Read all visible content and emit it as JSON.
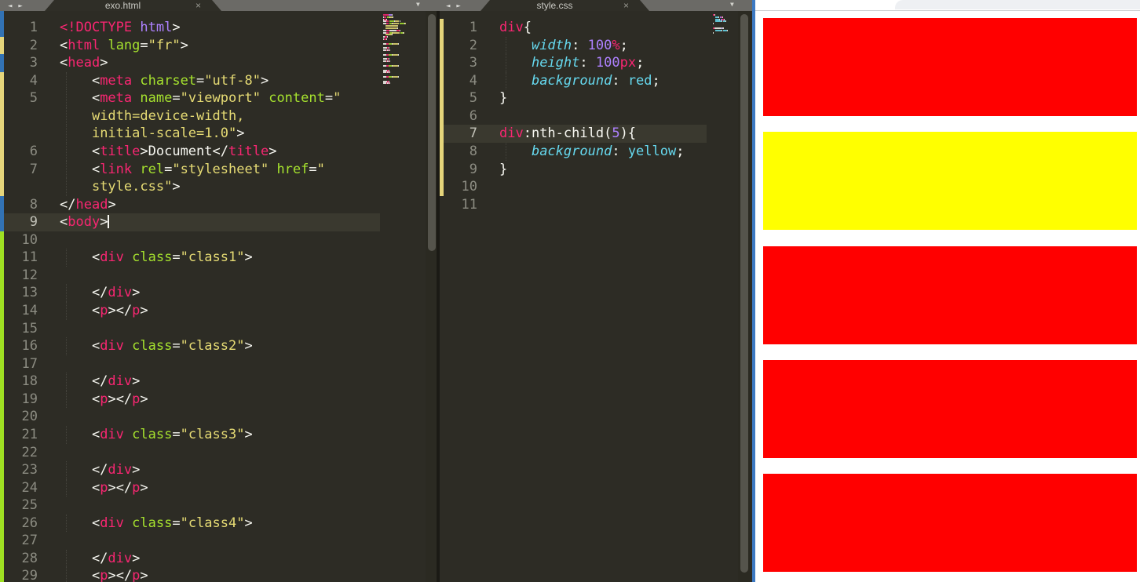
{
  "palette": {
    "w": "#f8f8f2",
    "p": "#f92672",
    "g": "#a6e22e",
    "y": "#e6db74",
    "u": "#ae81ff",
    "c": "#66d9ef",
    "cn": "#66d9ef",
    "marker_blue": "#3272b4",
    "marker_yellow": "#e5d57b",
    "marker_green": "#9ee022",
    "editor_bg": "#2d2c25",
    "tabbar_bg": "#6b6a66",
    "browser_accent": "#3c79c2",
    "red_block": "#ff0000",
    "yellow_block": "#ffff00"
  },
  "tabbar": {
    "back_arrow": "◄",
    "forward_arrow": "►",
    "overflow_arrow": "▼",
    "close_glyph": "×"
  },
  "left_pane": {
    "tab_title": "exo.html",
    "marker_column_bg": "blue",
    "rows": [
      {
        "n": "1",
        "m": "b",
        "seg": [
          [
            "<!DOCTYPE",
            "p"
          ],
          [
            " html",
            "u"
          ],
          [
            ">",
            "w"
          ]
        ]
      },
      {
        "n": "2",
        "m": "y",
        "seg": [
          [
            "<",
            "w"
          ],
          [
            "html",
            "p"
          ],
          [
            " ",
            "w"
          ],
          [
            "lang",
            "g"
          ],
          [
            "=",
            "w"
          ],
          [
            "\"fr\"",
            "y"
          ],
          [
            ">",
            "w"
          ]
        ]
      },
      {
        "n": "3",
        "m": "b",
        "seg": [
          [
            "<",
            "w"
          ],
          [
            "head",
            "p"
          ],
          [
            ">",
            "w"
          ]
        ]
      },
      {
        "n": "4",
        "m": "y",
        "ind": 1,
        "seg": [
          [
            "    <",
            "w"
          ],
          [
            "meta",
            "p"
          ],
          [
            " ",
            "w"
          ],
          [
            "charset",
            "g"
          ],
          [
            "=",
            "w"
          ],
          [
            "\"utf-8\"",
            "y"
          ],
          [
            ">",
            "w"
          ]
        ]
      },
      {
        "n": "5",
        "m": "y",
        "ind": 1,
        "seg": [
          [
            "    <",
            "w"
          ],
          [
            "meta",
            "p"
          ],
          [
            " ",
            "w"
          ],
          [
            "name",
            "g"
          ],
          [
            "=",
            "w"
          ],
          [
            "\"viewport\"",
            "y"
          ],
          [
            " ",
            "w"
          ],
          [
            "content",
            "g"
          ],
          [
            "=",
            "w"
          ],
          [
            "\"",
            "y"
          ]
        ]
      },
      {
        "n": "",
        "m": "y",
        "ind": 1,
        "seg": [
          [
            "    ",
            "w"
          ],
          [
            "width=device-width,",
            "y"
          ]
        ]
      },
      {
        "n": "",
        "m": "y",
        "ind": 1,
        "seg": [
          [
            "    ",
            "w"
          ],
          [
            "initial-scale=1.0\"",
            "y"
          ],
          [
            ">",
            "w"
          ]
        ]
      },
      {
        "n": "6",
        "m": "y",
        "ind": 1,
        "seg": [
          [
            "    <",
            "w"
          ],
          [
            "title",
            "p"
          ],
          [
            ">",
            "w"
          ],
          [
            "Document",
            "w"
          ],
          [
            "</",
            "w"
          ],
          [
            "title",
            "p"
          ],
          [
            ">",
            "w"
          ]
        ]
      },
      {
        "n": "7",
        "m": "y",
        "ind": 1,
        "seg": [
          [
            "    <",
            "w"
          ],
          [
            "link",
            "p"
          ],
          [
            " ",
            "w"
          ],
          [
            "rel",
            "g"
          ],
          [
            "=",
            "w"
          ],
          [
            "\"stylesheet\"",
            "y"
          ],
          [
            " ",
            "w"
          ],
          [
            "href",
            "g"
          ],
          [
            "=",
            "w"
          ],
          [
            "\"",
            "y"
          ]
        ]
      },
      {
        "n": "",
        "m": "y",
        "ind": 1,
        "seg": [
          [
            "    ",
            "w"
          ],
          [
            "style.css\"",
            "y"
          ],
          [
            ">",
            "w"
          ]
        ]
      },
      {
        "n": "8",
        "m": "b",
        "seg": [
          [
            "</",
            "w"
          ],
          [
            "head",
            "p"
          ],
          [
            ">",
            "w"
          ]
        ]
      },
      {
        "n": "9",
        "m": "b",
        "hl": true,
        "cursor": true,
        "seg": [
          [
            "<",
            "w"
          ],
          [
            "body",
            "p"
          ],
          [
            ">",
            "w"
          ]
        ]
      },
      {
        "n": "10",
        "m": "g",
        "seg": []
      },
      {
        "n": "11",
        "m": "g",
        "ind": 1,
        "seg": [
          [
            "    <",
            "w"
          ],
          [
            "div",
            "p"
          ],
          [
            " ",
            "w"
          ],
          [
            "class",
            "g"
          ],
          [
            "=",
            "w"
          ],
          [
            "\"class1\"",
            "y"
          ],
          [
            ">",
            "w"
          ]
        ]
      },
      {
        "n": "12",
        "m": "g",
        "seg": []
      },
      {
        "n": "13",
        "m": "g",
        "ind": 1,
        "seg": [
          [
            "    </",
            "w"
          ],
          [
            "div",
            "p"
          ],
          [
            ">",
            "w"
          ]
        ]
      },
      {
        "n": "14",
        "m": "g",
        "ind": 1,
        "seg": [
          [
            "    <",
            "w"
          ],
          [
            "p",
            "p"
          ],
          [
            ">",
            "w"
          ],
          [
            "</",
            "w"
          ],
          [
            "p",
            "p"
          ],
          [
            ">",
            "w"
          ]
        ]
      },
      {
        "n": "15",
        "m": "g",
        "seg": []
      },
      {
        "n": "16",
        "m": "g",
        "ind": 1,
        "seg": [
          [
            "    <",
            "w"
          ],
          [
            "div",
            "p"
          ],
          [
            " ",
            "w"
          ],
          [
            "class",
            "g"
          ],
          [
            "=",
            "w"
          ],
          [
            "\"class2\"",
            "y"
          ],
          [
            ">",
            "w"
          ]
        ]
      },
      {
        "n": "17",
        "m": "g",
        "seg": []
      },
      {
        "n": "18",
        "m": "g",
        "ind": 1,
        "seg": [
          [
            "    </",
            "w"
          ],
          [
            "div",
            "p"
          ],
          [
            ">",
            "w"
          ]
        ]
      },
      {
        "n": "19",
        "m": "g",
        "ind": 1,
        "seg": [
          [
            "    <",
            "w"
          ],
          [
            "p",
            "p"
          ],
          [
            ">",
            "w"
          ],
          [
            "</",
            "w"
          ],
          [
            "p",
            "p"
          ],
          [
            ">",
            "w"
          ]
        ]
      },
      {
        "n": "20",
        "m": "g",
        "seg": []
      },
      {
        "n": "21",
        "m": "g",
        "ind": 1,
        "seg": [
          [
            "    <",
            "w"
          ],
          [
            "div",
            "p"
          ],
          [
            " ",
            "w"
          ],
          [
            "class",
            "g"
          ],
          [
            "=",
            "w"
          ],
          [
            "\"class3\"",
            "y"
          ],
          [
            ">",
            "w"
          ]
        ]
      },
      {
        "n": "22",
        "m": "g",
        "seg": []
      },
      {
        "n": "23",
        "m": "g",
        "ind": 1,
        "seg": [
          [
            "    </",
            "w"
          ],
          [
            "div",
            "p"
          ],
          [
            ">",
            "w"
          ]
        ]
      },
      {
        "n": "24",
        "m": "g",
        "ind": 1,
        "seg": [
          [
            "    <",
            "w"
          ],
          [
            "p",
            "p"
          ],
          [
            ">",
            "w"
          ],
          [
            "</",
            "w"
          ],
          [
            "p",
            "p"
          ],
          [
            ">",
            "w"
          ]
        ]
      },
      {
        "n": "25",
        "m": "g",
        "seg": []
      },
      {
        "n": "26",
        "m": "g",
        "ind": 1,
        "seg": [
          [
            "    <",
            "w"
          ],
          [
            "div",
            "p"
          ],
          [
            " ",
            "w"
          ],
          [
            "class",
            "g"
          ],
          [
            "=",
            "w"
          ],
          [
            "\"class4\"",
            "y"
          ],
          [
            ">",
            "w"
          ]
        ]
      },
      {
        "n": "27",
        "m": "g",
        "seg": []
      },
      {
        "n": "28",
        "m": "g",
        "ind": 1,
        "seg": [
          [
            "    </",
            "w"
          ],
          [
            "div",
            "p"
          ],
          [
            ">",
            "w"
          ]
        ]
      },
      {
        "n": "29",
        "m": "g",
        "ind": 1,
        "seg": [
          [
            "    <",
            "w"
          ],
          [
            "p",
            "p"
          ],
          [
            ">",
            "w"
          ],
          [
            "</",
            "w"
          ],
          [
            "p",
            "p"
          ],
          [
            ">",
            "w"
          ]
        ]
      }
    ]
  },
  "right_pane": {
    "tab_title": "style.css",
    "marker_column_bg": "none",
    "rows": [
      {
        "n": "1",
        "m": "y",
        "seg": [
          [
            "div",
            "p"
          ],
          [
            "{",
            "w"
          ]
        ]
      },
      {
        "n": "2",
        "m": "y",
        "ind": 1,
        "seg": [
          [
            "    ",
            "w"
          ],
          [
            "width",
            "c"
          ],
          [
            ":",
            "w"
          ],
          [
            " ",
            "w"
          ],
          [
            "100",
            "u"
          ],
          [
            "%",
            "p"
          ],
          [
            ";",
            "w"
          ]
        ]
      },
      {
        "n": "3",
        "m": "y",
        "ind": 1,
        "seg": [
          [
            "    ",
            "w"
          ],
          [
            "height",
            "c"
          ],
          [
            ":",
            "w"
          ],
          [
            " ",
            "w"
          ],
          [
            "100",
            "u"
          ],
          [
            "px",
            "p"
          ],
          [
            ";",
            "w"
          ]
        ]
      },
      {
        "n": "4",
        "m": "y",
        "ind": 1,
        "seg": [
          [
            "    ",
            "w"
          ],
          [
            "background",
            "c"
          ],
          [
            ":",
            "w"
          ],
          [
            " ",
            "w"
          ],
          [
            "red",
            "cn"
          ],
          [
            ";",
            "w"
          ]
        ]
      },
      {
        "n": "5",
        "m": "y",
        "seg": [
          [
            "}",
            "w"
          ]
        ]
      },
      {
        "n": "6",
        "m": "y",
        "seg": []
      },
      {
        "n": "7",
        "m": "y",
        "hl": true,
        "seg": [
          [
            "div",
            "p"
          ],
          [
            ":nth-child(",
            "w"
          ],
          [
            "5",
            "u"
          ],
          [
            "){",
            "w"
          ]
        ]
      },
      {
        "n": "8",
        "m": "y",
        "ind": 1,
        "seg": [
          [
            "    ",
            "w"
          ],
          [
            "background",
            "c"
          ],
          [
            ":",
            "w"
          ],
          [
            " ",
            "w"
          ],
          [
            "yellow",
            "cn"
          ],
          [
            ";",
            "w"
          ]
        ]
      },
      {
        "n": "9",
        "m": "y",
        "seg": [
          [
            "}",
            "w"
          ]
        ]
      },
      {
        "n": "10",
        "m": "y",
        "seg": []
      },
      {
        "n": "11",
        "m": "",
        "seg": []
      }
    ]
  },
  "browser": {
    "blocks": [
      {
        "bg": "#ff0000",
        "name": "red"
      },
      {
        "bg": "#ffff00",
        "name": "yellow"
      },
      {
        "bg": "#ff0000",
        "name": "red"
      },
      {
        "bg": "#ff0000",
        "name": "red"
      },
      {
        "bg": "#ff0000",
        "name": "red"
      }
    ],
    "block_height": 125,
    "block_gap": 20.25,
    "top_margin": 9
  }
}
